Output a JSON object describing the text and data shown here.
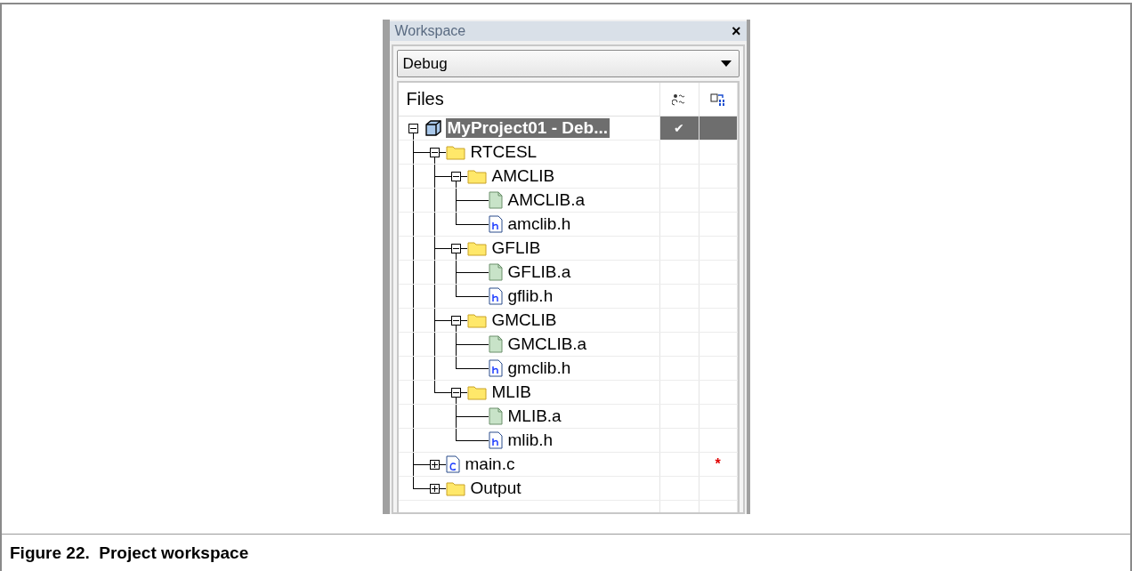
{
  "panel": {
    "title": "Workspace",
    "close": "×"
  },
  "configuration": {
    "value": "Debug"
  },
  "columns": {
    "files": "Files"
  },
  "tree": {
    "name": "MyProject01 - Deb...",
    "kind": "project",
    "selected": true,
    "expanded": true,
    "options": "✔",
    "children": [
      {
        "name": "RTCESL",
        "kind": "folder",
        "selected": false,
        "expanded": true,
        "children": [
          {
            "name": "AMCLIB",
            "kind": "folder",
            "selected": false,
            "expanded": true,
            "children": [
              {
                "name": "AMCLIB.a",
                "kind": "library",
                "selected": false
              },
              {
                "name": "amclib.h",
                "kind": "header",
                "selected": false
              }
            ]
          },
          {
            "name": "GFLIB",
            "kind": "folder",
            "selected": false,
            "expanded": true,
            "children": [
              {
                "name": "GFLIB.a",
                "kind": "library",
                "selected": false
              },
              {
                "name": "gflib.h",
                "kind": "header",
                "selected": false
              }
            ]
          },
          {
            "name": "GMCLIB",
            "kind": "folder",
            "selected": false,
            "expanded": true,
            "children": [
              {
                "name": "GMCLIB.a",
                "kind": "library",
                "selected": false
              },
              {
                "name": "gmclib.h",
                "kind": "header",
                "selected": false
              }
            ]
          },
          {
            "name": "MLIB",
            "kind": "folder",
            "selected": false,
            "expanded": true,
            "children": [
              {
                "name": "MLIB.a",
                "kind": "library",
                "selected": false
              },
              {
                "name": "mlib.h",
                "kind": "header",
                "selected": false
              }
            ]
          }
        ]
      },
      {
        "name": "main.c",
        "kind": "source",
        "selected": false,
        "expanded": false,
        "modified": "*"
      },
      {
        "name": "Output",
        "kind": "folder",
        "selected": false,
        "expanded": false
      }
    ]
  },
  "caption": "Figure 22.  Project workspace"
}
